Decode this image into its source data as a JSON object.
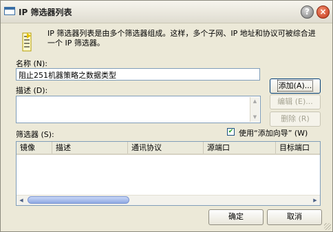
{
  "window": {
    "title": "IP 筛选器列表"
  },
  "titlebar_buttons": {
    "help": "?",
    "close": "×"
  },
  "intro": {
    "text": "IP 筛选器列表是由多个筛选器组成。这样，多个子网、IP 地址和协议可被综合进一个 IP 筛选器。"
  },
  "name_field": {
    "label": "名称 (N):",
    "value": "阻止251机器策略之数据类型"
  },
  "description_field": {
    "label": "描述 (D):",
    "value": ""
  },
  "buttons": {
    "add": "添加(A)...",
    "edit": "编辑 (E)...",
    "delete": "删除 (R)",
    "ok": "确定",
    "cancel": "取消"
  },
  "filters": {
    "label": "筛选器 (S):",
    "use_wizard_label": "使用“添加向导” (W)",
    "use_wizard_checked": true,
    "columns": [
      "镜像",
      "描述",
      "通讯协议",
      "源端口",
      "目标端口"
    ],
    "rows": []
  },
  "icons": {
    "filter": "filter-list-icon",
    "check": "✔"
  },
  "colors": {
    "window_bg": "#ece9d8",
    "input_border": "#7f9db9",
    "close_red": "#c2361a",
    "scroll_blue": "#8fa9e3"
  }
}
